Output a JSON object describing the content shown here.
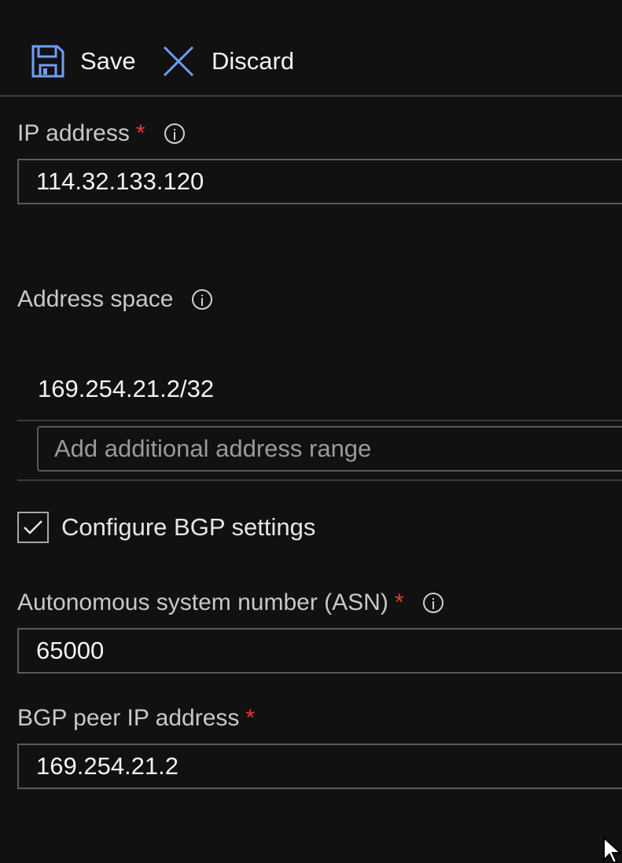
{
  "toolbar": {
    "save_label": "Save",
    "discard_label": "Discard",
    "save_icon": "floppy-disk-icon",
    "discard_icon": "close-icon"
  },
  "ip_address": {
    "label": "IP address",
    "required_marker": "*",
    "value": "114.32.133.120"
  },
  "address_space": {
    "label": "Address space",
    "entries": [
      "169.254.21.2/32"
    ],
    "add_placeholder": "Add additional address range"
  },
  "bgp": {
    "checkbox_label": "Configure BGP settings",
    "checked": true,
    "asn_label": "Autonomous system number (ASN)",
    "asn_required_marker": "*",
    "asn_value": "65000",
    "peer_label": "BGP peer IP address",
    "peer_required_marker": "*",
    "peer_value": "169.254.21.2"
  },
  "colors": {
    "background": "#111111",
    "accent_icon": "#6f9ff5",
    "required": "#e53935"
  }
}
